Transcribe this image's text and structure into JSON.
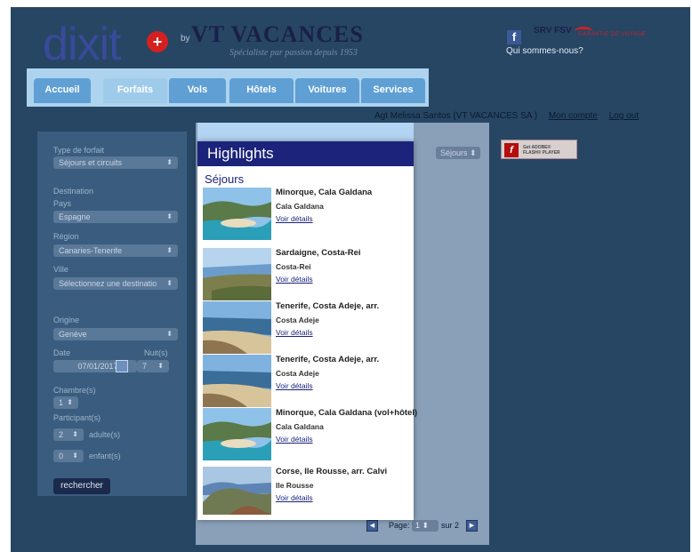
{
  "header": {
    "logo_text": "dixit",
    "by_text": "by",
    "brand": "VT VACANCES",
    "tagline": "Spécialiste par passion depuis 1953",
    "srv_text": "SRV FSV",
    "guarantee_text": "GARANTIE DE VOYAGE",
    "about_link": "Qui sommes-nous?"
  },
  "nav": {
    "tabs": [
      {
        "label": "Accueil"
      },
      {
        "label": "Forfaits",
        "active": true
      },
      {
        "label": "Vols"
      },
      {
        "label": "Hôtels"
      },
      {
        "label": "Voitures"
      },
      {
        "label": "Services"
      }
    ]
  },
  "user": {
    "agent": "Agt Melissa Santos (VT VACANCES SA )",
    "account_link": "Mon compte",
    "logout_link": "Log out"
  },
  "search_form": {
    "type_label": "Type de forfait",
    "type_value": "Séjours et circuits",
    "destination_label": "Destination",
    "country_label": "Pays",
    "country_value": "Espagne",
    "region_label": "Région",
    "region_value": "Canaries-Tenerife",
    "city_label": "Ville",
    "city_value": "Sélectionnez une destinatio",
    "origin_label": "Origine",
    "origin_value": "Genève",
    "date_label": "Date",
    "date_value": "07/01/2017",
    "nights_label": "Nuit(s)",
    "nights_value": "7",
    "rooms_label": "Chambre(s)",
    "rooms_value": "1",
    "participants_label": "Participant(s)",
    "adults_value": "2",
    "adults_label": "adulte(s)",
    "children_value": "0",
    "children_label": "enfant(s)",
    "search_button": "rechercher"
  },
  "results": {
    "filter_value": "Séjours",
    "flash_line1": "Get ADOBE®",
    "flash_line2": "FLASH® PLAYER",
    "page_label": "Page:",
    "page_value": "1",
    "page_total": "sur 2"
  },
  "highlights": {
    "title": "Highlights",
    "section": "Séjours",
    "items": [
      {
        "title": "Minorque, Cala Galdana",
        "sub": "Cala Galdana",
        "link": "Voir détails",
        "image": "bay"
      },
      {
        "title": "Sardaigne, Costa-Rei",
        "sub": "Costa-Rei",
        "link": "Voir détails",
        "image": "coast"
      },
      {
        "title": "Tenerife, Costa Adeje, arr.",
        "sub": "Costa Adeje",
        "link": "Voir détails",
        "image": "beach"
      },
      {
        "title": "Tenerife, Costa Adeje, arr.",
        "sub": "Costa Adeje",
        "link": "Voir détails",
        "image": "beach"
      },
      {
        "title": "Minorque, Cala Galdana (vol+hôtel)",
        "sub": "Cala Galdana",
        "link": "Voir détails",
        "image": "bay"
      },
      {
        "title": "Corse, Ile Rousse, arr. Calvi",
        "sub": "Ile Rousse",
        "link": "Voir détails",
        "image": "island"
      }
    ]
  }
}
